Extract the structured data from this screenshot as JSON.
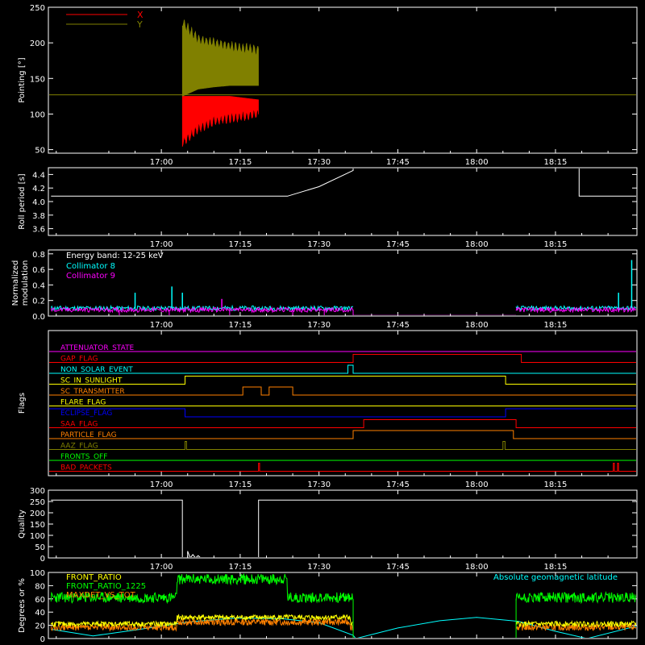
{
  "chart_data": [
    {
      "id": "pointing",
      "type": "line",
      "ylabel": "Pointing [°]",
      "yticks": [
        50,
        100,
        150,
        200,
        250
      ],
      "ylim": [
        45,
        250
      ],
      "xticks": [
        "17:00",
        "17:15",
        "17:30",
        "17:45",
        "18:00",
        "18:15"
      ],
      "xlim_minutes": [
        -21.5,
        90.5
      ],
      "series": [
        {
          "name": "X",
          "color": "#ff0000",
          "segment": [
            4,
            18.5
          ],
          "band": [
            [
              4,
              60,
              125
            ],
            [
              7,
              80,
              125
            ],
            [
              10,
              90,
              125
            ],
            [
              13,
              95,
              125
            ],
            [
              18.5,
              100,
              120
            ]
          ]
        },
        {
          "name": "Y",
          "color": "#808000",
          "segment": [
            4,
            18.5
          ],
          "band": [
            [
              4,
              125,
              228
            ],
            [
              7,
              135,
              205
            ],
            [
              10,
              138,
              200
            ],
            [
              13,
              140,
              195
            ],
            [
              18.5,
              140,
              190
            ]
          ]
        }
      ],
      "reference_level": 127,
      "legend": "top-left"
    },
    {
      "id": "roll",
      "type": "line",
      "ylabel": "Roll period [s]",
      "yticks": [
        "3.6",
        "3.8",
        "4.0",
        "4.2",
        "4.4"
      ],
      "ylim": [
        3.5,
        4.5
      ],
      "xticks": [
        "17:00",
        "17:15",
        "17:30",
        "17:45",
        "18:00",
        "18:15"
      ],
      "series": [
        {
          "name": "roll period",
          "color": "#ffffff",
          "points": [
            [
              -21,
              4.08
            ],
            [
              24,
              4.08
            ],
            [
              30,
              4.22
            ],
            [
              36.5,
              4.46
            ],
            [
              36.5,
              4.5
            ]
          ]
        },
        {
          "name": "roll period 2",
          "color": "#ffffff",
          "points": [
            [
              79.5,
              4.5
            ],
            [
              79.5,
              4.08
            ],
            [
              90.5,
              4.08
            ]
          ]
        }
      ]
    },
    {
      "id": "modulation",
      "type": "line",
      "ylabel": "Normalized modulation",
      "yticks": [
        "0.0",
        "0.2",
        "0.4",
        "0.6",
        "0.8"
      ],
      "ylim": [
        0,
        0.85
      ],
      "xticks": [
        "17:00",
        "17:15",
        "17:30",
        "17:45",
        "18:00",
        "18:15"
      ],
      "annotation": "Energy band: 12-25 keV",
      "series": [
        {
          "name": "Collimator 8",
          "color": "#00ffff",
          "segments": [
            [
              -21,
              36.5
            ],
            [
              67.5,
              90.5
            ]
          ],
          "level": 0.1
        },
        {
          "name": "Collimator 9",
          "color": "#ff00ff",
          "segments": [
            [
              -21,
              36.5
            ],
            [
              67.5,
              90.5
            ]
          ],
          "level": 0.08
        }
      ],
      "spikes": [
        {
          "x": 2,
          "y": 0.38,
          "color": "#00ffff"
        },
        {
          "x": 4,
          "y": 0.3,
          "color": "#00ffff"
        },
        {
          "x": -5,
          "y": 0.3,
          "color": "#00ffff"
        },
        {
          "x": 89.5,
          "y": 0.72,
          "color": "#00ffff"
        },
        {
          "x": 87,
          "y": 0.3,
          "color": "#00ffff"
        },
        {
          "x": 11.5,
          "y": 0.22,
          "color": "#ff00ff"
        }
      ]
    },
    {
      "id": "flags",
      "type": "line",
      "ylabel": "Flags",
      "xticks": [
        "17:00",
        "17:15",
        "17:30",
        "17:45",
        "18:00",
        "18:15"
      ],
      "rows": [
        {
          "label": "ATTENUATOR_STATE",
          "color": "#ff00ff",
          "steps": []
        },
        {
          "label": "GAP_FLAG",
          "color": "#ff0000",
          "steps": [
            [
              36.5,
              1
            ],
            [
              68.5,
              0
            ]
          ]
        },
        {
          "label": "NON_SOLAR_EVENT",
          "color": "#00ffff",
          "steps": [
            [
              35.5,
              1
            ],
            [
              36.5,
              0
            ]
          ]
        },
        {
          "label": "SC_IN_SUNLIGHT",
          "color": "#ffff00",
          "steps": [
            [
              4.5,
              1
            ],
            [
              65.5,
              0
            ]
          ]
        },
        {
          "label": "SC_TRANSMITTER",
          "color": "#ff8000",
          "steps": [
            [
              15.5,
              1
            ],
            [
              19,
              0
            ],
            [
              20.5,
              1
            ],
            [
              25,
              0
            ]
          ]
        },
        {
          "label": "FLARE_FLAG",
          "color": "#ffff00",
          "steps": []
        },
        {
          "label": "ECLIPSE_FLAG",
          "color": "#0000ff",
          "steps": [
            [
              0,
              1
            ],
            [
              4.5,
              0
            ],
            [
              65.5,
              1
            ]
          ],
          "initial": 1
        },
        {
          "label": "SAA_FLAG",
          "color": "#ff0000",
          "steps": [
            [
              38.5,
              1
            ],
            [
              67.5,
              0
            ]
          ]
        },
        {
          "label": "PARTICLE_FLAG",
          "color": "#ff8000",
          "steps": [
            [
              36.5,
              1
            ],
            [
              67,
              0
            ]
          ]
        },
        {
          "label": "AAZ_FLAG",
          "color": "#808000",
          "steps": [
            [
              4.5,
              1
            ],
            [
              4.8,
              0
            ],
            [
              65,
              1
            ],
            [
              65.4,
              0
            ]
          ]
        },
        {
          "label": "FRONTS_OFF",
          "color": "#00ff00",
          "steps": []
        },
        {
          "label": "BAD_PACKETS",
          "color": "#ff0000",
          "steps": [
            [
              18.5,
              1
            ],
            [
              18.7,
              0
            ],
            [
              86,
              1
            ],
            [
              86.2,
              0
            ],
            [
              86.8,
              1
            ],
            [
              87,
              0
            ]
          ]
        }
      ]
    },
    {
      "id": "quality",
      "type": "line",
      "ylabel": "Quality",
      "yticks": [
        0,
        50,
        100,
        150,
        200,
        250,
        300
      ],
      "ylim": [
        0,
        300
      ],
      "xticks": [
        "17:00",
        "17:15",
        "17:30",
        "17:45",
        "18:00",
        "18:15"
      ],
      "series": [
        {
          "name": "quality",
          "color": "#ffffff",
          "points": [
            [
              -21,
              256
            ],
            [
              4,
              256
            ],
            [
              4,
              0
            ],
            [
              5,
              0
            ],
            [
              5,
              30
            ],
            [
              5.5,
              0
            ],
            [
              6,
              15
            ],
            [
              6.5,
              0
            ],
            [
              7,
              10
            ],
            [
              7.5,
              0
            ],
            [
              18.5,
              0
            ],
            [
              18.5,
              256
            ],
            [
              90.5,
              256
            ]
          ]
        }
      ]
    },
    {
      "id": "ratios",
      "type": "line",
      "ylabel": "Degrees or %",
      "yticks": [
        0,
        20,
        40,
        60,
        80,
        100
      ],
      "ylim": [
        0,
        100
      ],
      "xticks": [
        "17:00",
        "17:15",
        "17:30",
        "17:45",
        "18:00",
        "18:15"
      ],
      "xlabels": [],
      "annotation_right": "Absolute geomagnetic latitude",
      "series": [
        {
          "name": "FRONT_RATIO",
          "color": "#ffff00",
          "segments": [
            [
              -21,
              36.5
            ],
            [
              67.5,
              90.5
            ]
          ],
          "level": 22
        },
        {
          "name": "FRONT_RATIO_1225",
          "color": "#00ff00",
          "segments": [
            [
              -21,
              36.5
            ],
            [
              67.5,
              90.5
            ]
          ],
          "levels": [
            [
              -21,
              3,
              62
            ],
            [
              3,
              24,
              90
            ],
            [
              24,
              36.5,
              62
            ],
            [
              67.5,
              90.5,
              62
            ]
          ]
        },
        {
          "name": "MAXDET_VS_TOT",
          "color": "#ff8000",
          "segments": [
            [
              -21,
              36.5
            ],
            [
              67.5,
              90.5
            ]
          ],
          "level": 17
        },
        {
          "name": "Absolute geomagnetic latitude",
          "color": "#00ffff",
          "points": [
            [
              -21,
              14
            ],
            [
              -13,
              4
            ],
            [
              -4,
              14
            ],
            [
              5,
              25
            ],
            [
              14,
              31
            ],
            [
              23,
              30
            ],
            [
              30,
              24
            ],
            [
              36.5,
              5
            ],
            [
              37,
              0
            ],
            [
              45,
              16
            ],
            [
              53,
              27
            ],
            [
              60,
              32
            ],
            [
              68,
              26
            ],
            [
              75,
              11
            ],
            [
              81,
              0
            ],
            [
              90.5,
              19
            ]
          ]
        }
      ],
      "legend": "top-left"
    }
  ]
}
